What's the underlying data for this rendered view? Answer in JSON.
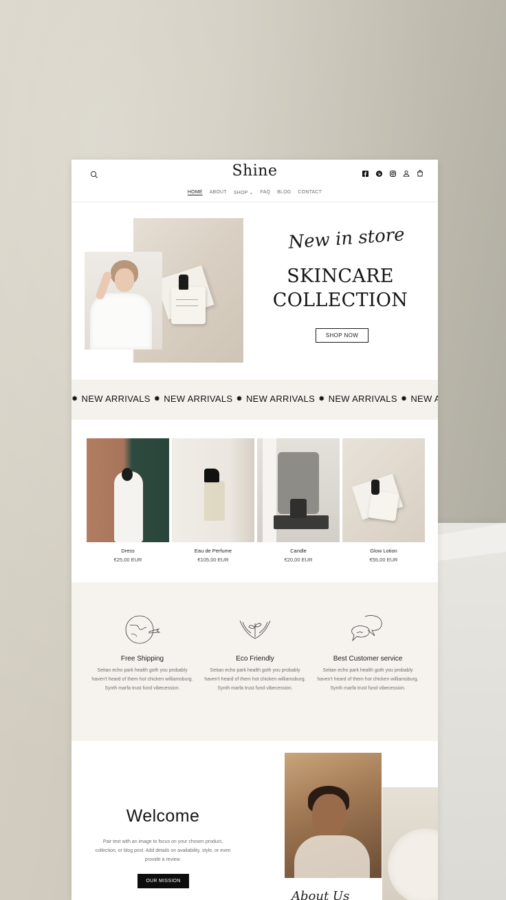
{
  "store": {
    "logo": "Shine",
    "nav": [
      "HOME",
      "ABOUT",
      "SHOP",
      "FAQ",
      "BLOG",
      "CONTACT"
    ],
    "active_nav": "HOME"
  },
  "hero": {
    "script": "New in store",
    "title_line1": "SKINCARE",
    "title_line2": "COLLECTION",
    "button": "SHOP NOW"
  },
  "marquee": {
    "items": [
      "NEW ARRIVALS",
      "NEW ARRIVALS",
      "NEW ARRIVALS",
      "NEW ARRIVALS",
      "NEW ARRIVALS"
    ]
  },
  "products": [
    {
      "name": "Dress",
      "price": "€25,00 EUR"
    },
    {
      "name": "Eau de Perfume",
      "price": "€105,00 EUR"
    },
    {
      "name": "Candle",
      "price": "€20,00 EUR"
    },
    {
      "name": "Glow Lotion",
      "price": "€55,00 EUR"
    }
  ],
  "features": [
    {
      "title": "Free Shipping",
      "text": "Seitan echo park health goth you probably haven't heard of them hot chicken williamsburg. Synth marfa trust fund vibecession.",
      "icon": "globe-plane-icon"
    },
    {
      "title": "Eco Friendly",
      "text": "Seitan echo park health goth you probably haven't heard of them hot chicken williamsburg. Synth marfa trust fund vibecession.",
      "icon": "hands-plant-icon"
    },
    {
      "title": "Best Customer service",
      "text": "Seitan echo park health goth you probably haven't heard of them hot chicken williamsburg. Synth marfa trust fund vibecession.",
      "icon": "chat-bubbles-icon"
    }
  ],
  "welcome": {
    "title": "Welcome",
    "text": "Pair text with an image to focus on your chosen product, collection, or blog post. Add details on availability, style, or even provide a review.",
    "button": "OUR MISSION",
    "script": "About Us"
  },
  "colors": {
    "accent_bg": "#f6f3ef",
    "text": "#1a1a1a",
    "button_dark": "#0d0d0d"
  }
}
